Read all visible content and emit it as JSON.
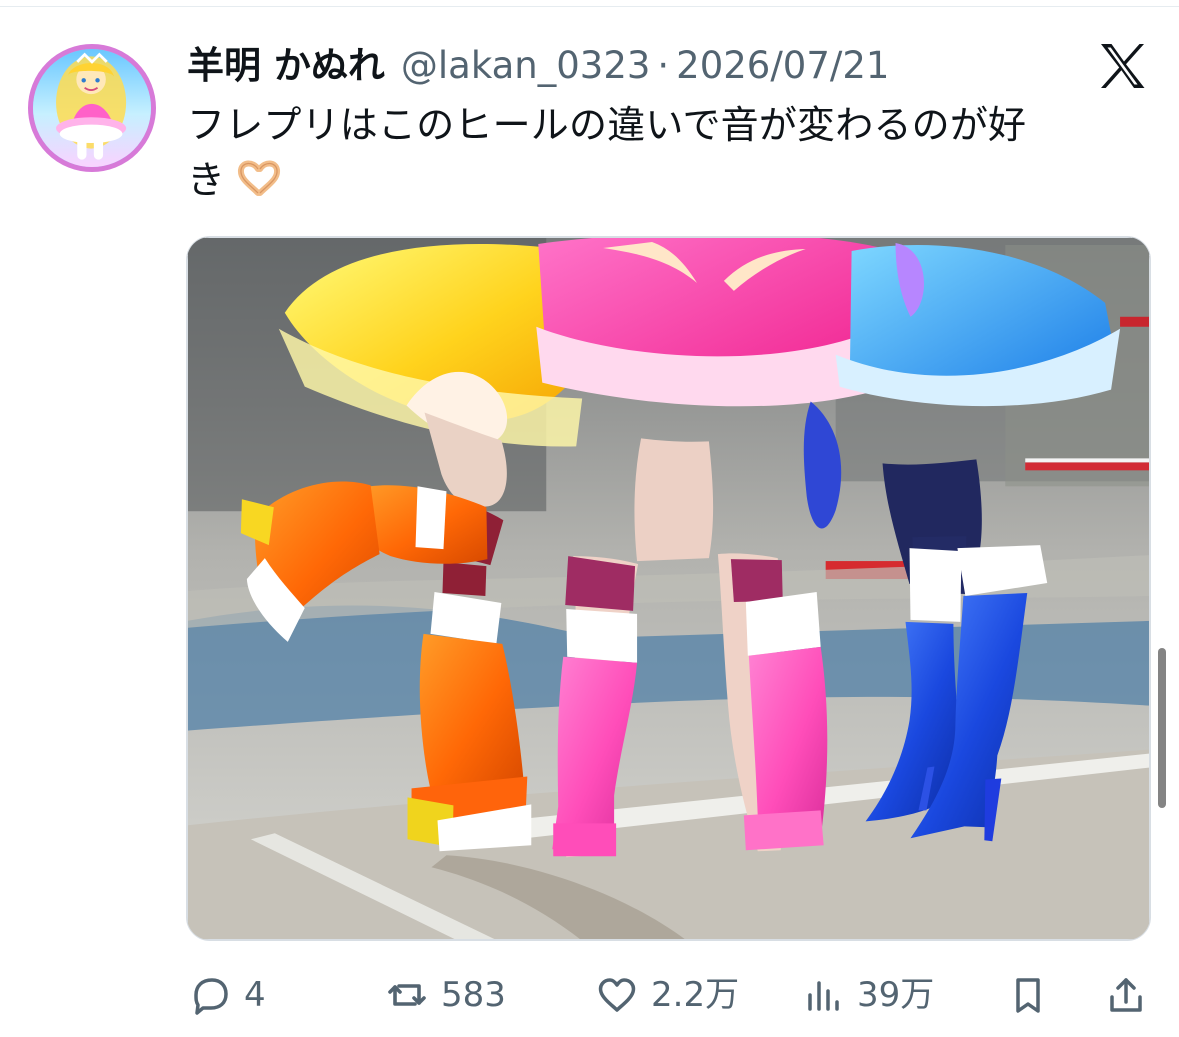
{
  "tweet": {
    "display_name": "羊明 かぬれ",
    "handle": "@lakan_0323",
    "separator": "·",
    "date": "2026/07/21",
    "text_line_1": "フレプリはこのヒールの違いで音が変わるのが好",
    "text_line_2": "き",
    "emoji": "heart-hands-emoji"
  },
  "platform": {
    "logo_icon": "x-logo-icon"
  },
  "media": {
    "type": "photo",
    "subject": "three-cosplay-boots-photo"
  },
  "actions": {
    "reply_count": "4",
    "retweet_count": "583",
    "like_count": "2.2万",
    "view_count": "39万",
    "reply_icon": "reply-icon",
    "retweet_icon": "retweet-icon",
    "like_icon": "heart-icon",
    "views_icon": "bar-chart-icon",
    "bookmark_icon": "bookmark-icon",
    "share_icon": "share-icon"
  },
  "colors": {
    "text_primary": "#0f1419",
    "text_secondary": "#536471",
    "avatar_border": "#d77ad8",
    "divider": "#e6ecf0"
  }
}
